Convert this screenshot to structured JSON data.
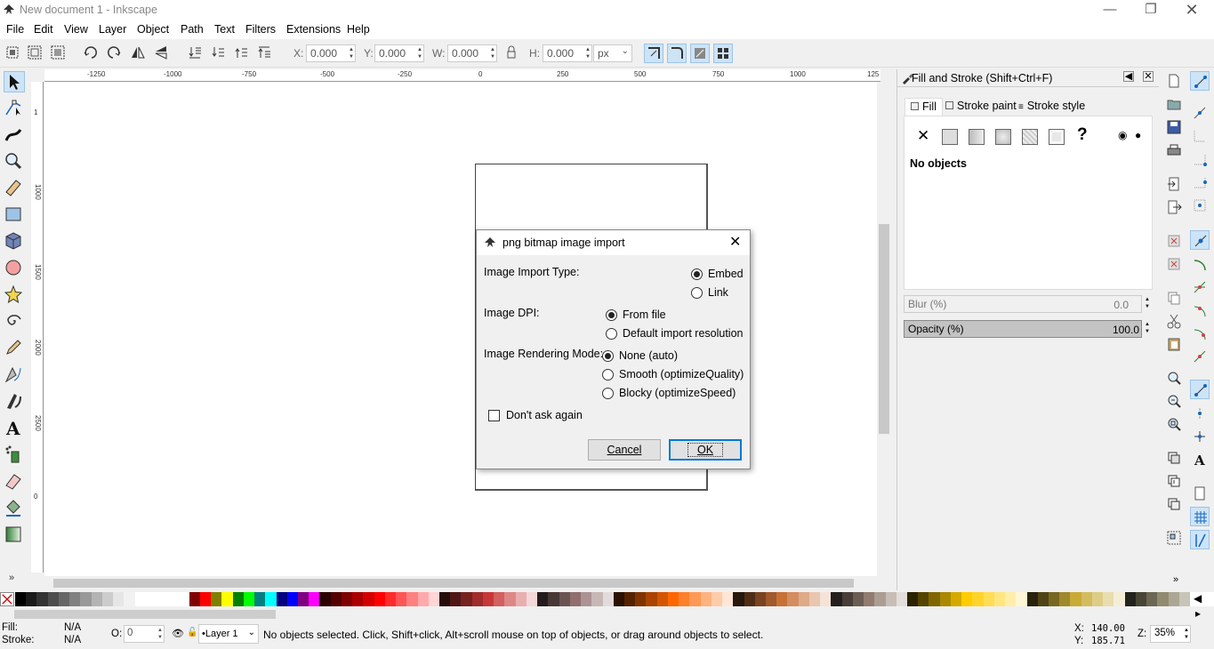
{
  "window": {
    "title": "New document 1 - Inkscape"
  },
  "menu": [
    "File",
    "Edit",
    "View",
    "Layer",
    "Object",
    "Path",
    "Text",
    "Filters",
    "Extensions",
    "Help"
  ],
  "toolbar": {
    "x_label": "X:",
    "x_value": "0.000",
    "y_label": "Y:",
    "y_value": "0.000",
    "w_label": "W:",
    "w_value": "0.000",
    "h_label": "H:",
    "h_value": "0.000",
    "unit": "px"
  },
  "ruler": {
    "top_ticks": [
      "-1250",
      "-1000",
      "-750",
      "-500",
      "-250",
      "0",
      "250",
      "500",
      "750",
      "1000",
      "125"
    ],
    "left_ticks": [
      "1",
      "1000",
      "1500",
      "2000",
      "2500",
      "0"
    ]
  },
  "dock": {
    "title": "Fill and Stroke (Shift+Ctrl+F)",
    "tabs": [
      "Fill",
      "Stroke paint",
      "Stroke style"
    ],
    "no_objects": "No objects",
    "blur_label": "Blur (%)",
    "blur_value": "0.0",
    "opacity_label": "Opacity (%)",
    "opacity_value": "100.0",
    "opacity_fill": 1.0
  },
  "dialog": {
    "title": "png bitmap image import",
    "import_type_label": "Image Import Type:",
    "import_type_options": [
      "Embed",
      "Link"
    ],
    "import_type_selected": 0,
    "dpi_label": "Image DPI:",
    "dpi_options": [
      "From file",
      "Default import resolution"
    ],
    "dpi_selected": 0,
    "render_label": "Image Rendering Mode:",
    "render_options": [
      "None (auto)",
      "Smooth (optimizeQuality)",
      "Blocky (optimizeSpeed)"
    ],
    "render_selected": 0,
    "dont_ask": "Don't ask again",
    "dont_ask_checked": false,
    "cancel": "Cancel",
    "ok": "OK"
  },
  "status": {
    "fill_label": "Fill:",
    "fill_value": "N/A",
    "stroke_label": "Stroke:",
    "stroke_value": "N/A",
    "opacity_label": "O:",
    "opacity_value": "0",
    "layer": "•Layer 1",
    "message": "No objects selected. Click, Shift+click, Alt+scroll mouse on top of objects, or drag around objects to select.",
    "cursor_x_label": "X:",
    "cursor_x": "140.00",
    "cursor_y_label": "Y:",
    "cursor_y": "185.71",
    "zoom_label": "Z:",
    "zoom": "35%"
  },
  "palette": [
    "#000000",
    "#1a1a1a",
    "#333333",
    "#4d4d4d",
    "#666666",
    "#808080",
    "#999999",
    "#b3b3b3",
    "#cccccc",
    "#e6e6e6",
    "#f2f2f2",
    "#ffffff",
    "#ffffff",
    "#ffffff",
    "#ffffff",
    "#ffffff",
    "#800000",
    "#ff0000",
    "#808000",
    "#ffff00",
    "#008000",
    "#00ff00",
    "#008080",
    "#00ffff",
    "#000080",
    "#0000ff",
    "#800080",
    "#ff00ff",
    "#2b0000",
    "#550000",
    "#800000",
    "#aa0000",
    "#d40000",
    "#ff0000",
    "#ff2a2a",
    "#ff5555",
    "#ff8080",
    "#ffaaaa",
    "#ffd5d5",
    "#280b0b",
    "#501616",
    "#782121",
    "#a02c2c",
    "#c83737",
    "#d35f5f",
    "#de8787",
    "#e9afaf",
    "#f4d7d7",
    "#241c1c",
    "#483737",
    "#6c5353",
    "#916f6f",
    "#ac9393",
    "#c8b7b7",
    "#e3dbdb",
    "#2b1100",
    "#552200",
    "#803300",
    "#aa4400",
    "#d45500",
    "#ff6600",
    "#ff7f2a",
    "#ff9955",
    "#ffb380",
    "#ffccaa",
    "#ffe6d5",
    "#28170b",
    "#502d16",
    "#784421",
    "#a05a2c",
    "#c87137",
    "#d38d5f",
    "#deaa87",
    "#e9c6af",
    "#f4e3d7",
    "#241f1c",
    "#483e37",
    "#6c5d53",
    "#917c6f",
    "#ac9d93",
    "#c8beb7",
    "#e3dedb",
    "#2b2200",
    "#554400",
    "#806600",
    "#aa8800",
    "#d4aa00",
    "#ffcc00",
    "#ffd42a",
    "#ffdd55",
    "#ffe680",
    "#ffeeaa",
    "#fff6d5",
    "#28220b",
    "#504416",
    "#786721",
    "#a0892c",
    "#c8ab37",
    "#d3bc5f",
    "#decd87",
    "#e9ddaf",
    "#f4eed7",
    "#24221c",
    "#484537",
    "#6c6753",
    "#918a6f",
    "#aca793",
    "#c8c4b7"
  ]
}
